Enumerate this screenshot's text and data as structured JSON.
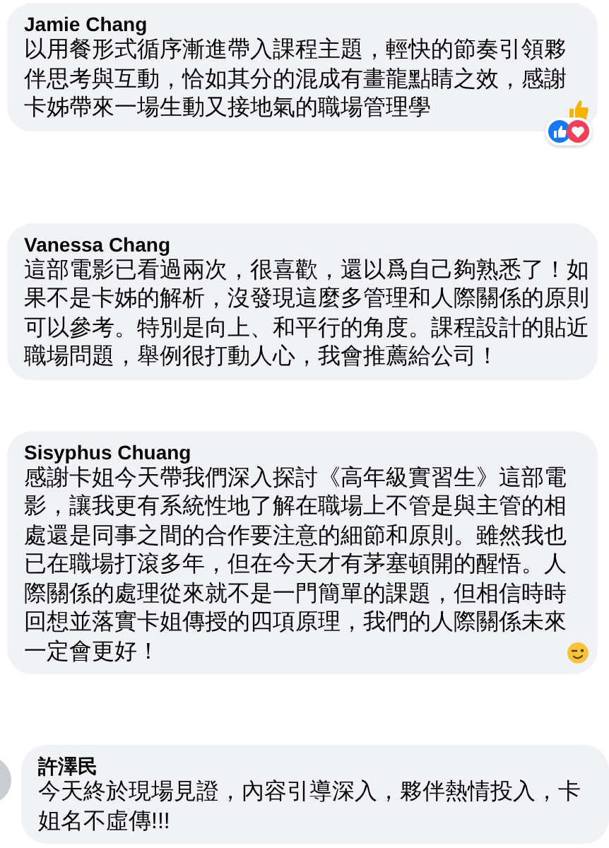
{
  "comments": [
    {
      "kind": "thumbs-up",
      "author": "Jamie Chang",
      "text": "以用餐形式循序漸進帶入課程主題，輕快的節奏引領夥伴思考與互動，恰如其分的混成有畫龍點睛之效，感謝卡姊帶來一場生動又接地氣的職場管理學",
      "avatar": false,
      "reactions": [
        {
          "kind": "like"
        },
        {
          "kind": "love"
        }
      ]
    },
    {
      "kind": "plain",
      "author": "Vanessa Chang",
      "text": "這部電影已看過兩次，很喜歡，還以爲自己夠熟悉了！如果不是卡姊的解析，沒發現這麼多管理和人際關係的原則可以參考。特別是向上、和平行的角度。課程設計的貼近職場問題，舉例很打動人心，我會推薦給公司！",
      "avatar": false
    },
    {
      "kind": "wink",
      "author": "Sisyphus Chuang",
      "text": "感謝卡姐今天帶我們深入探討《高年級實習生》這部電影，讓我更有系統性地了解在職場上不管是與主管的相處還是同事之間的合作要注意的細節和原則。雖然我也已在職場打滾多年，但在今天才有茅塞頓開的醒悟。人際關係的處理從來就不是一門簡單的課題，但相信時時回想並落實卡姐傳授的四項原理，我們的人際關係未來一定會更好！",
      "avatar": false
    },
    {
      "kind": "plain",
      "author": "許澤民",
      "text": "今天終於現場見證，內容引導深入，夥伴熱情投入，卡姐名不虛傳!!!",
      "avatar": true
    }
  ]
}
